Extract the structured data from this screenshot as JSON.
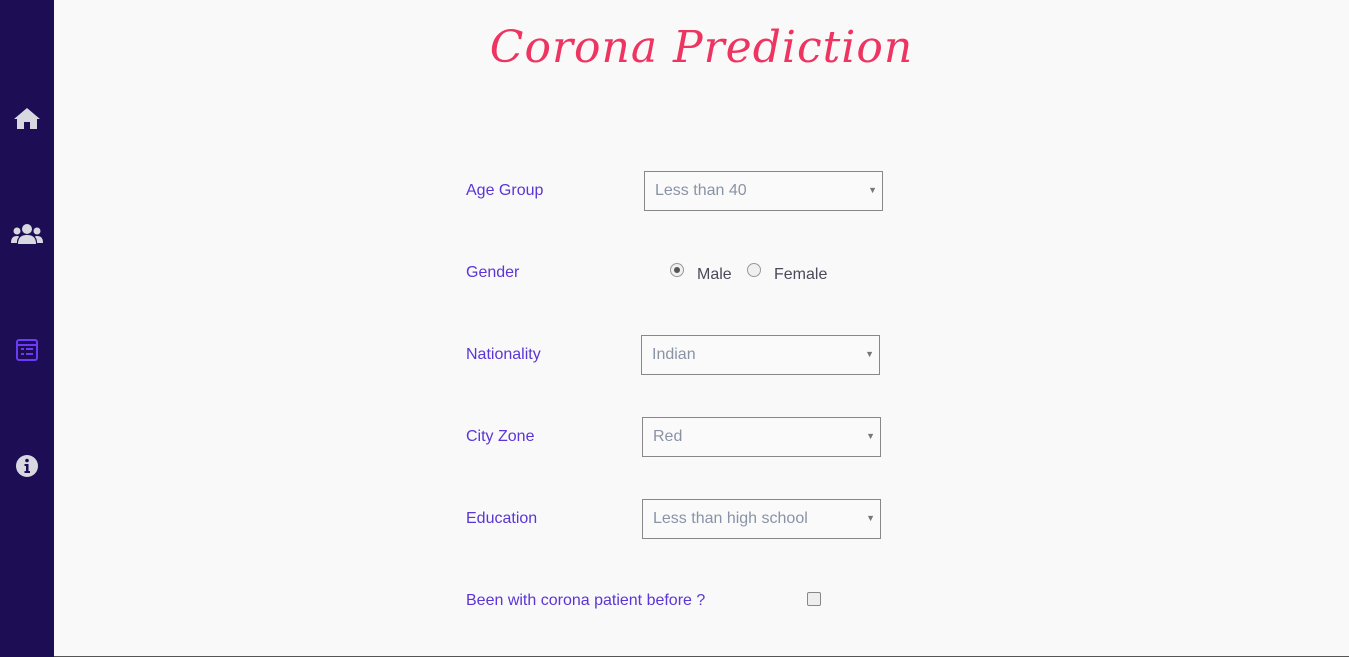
{
  "page": {
    "title": "Corona Prediction"
  },
  "sidebar": {
    "items": [
      {
        "icon": "home-icon"
      },
      {
        "icon": "users-icon"
      },
      {
        "icon": "form-icon",
        "active": true
      },
      {
        "icon": "info-icon"
      }
    ]
  },
  "form": {
    "age_group": {
      "label": "Age Group",
      "value": "Less than 40"
    },
    "gender": {
      "label": "Gender",
      "options": [
        "Male",
        "Female"
      ],
      "selected": "Male"
    },
    "nationality": {
      "label": "Nationality",
      "value": "Indian"
    },
    "city_zone": {
      "label": "City Zone",
      "value": "Red"
    },
    "education": {
      "label": "Education",
      "value": "Less than high school"
    },
    "contact": {
      "label": "Been with corona patient before ?",
      "checked": false
    }
  },
  "colors": {
    "sidebar": "#1d0d55",
    "title": "#ee3460",
    "label": "#5b35d6",
    "active_icon": "#6a3cf5",
    "icon": "#d8d8e0"
  }
}
